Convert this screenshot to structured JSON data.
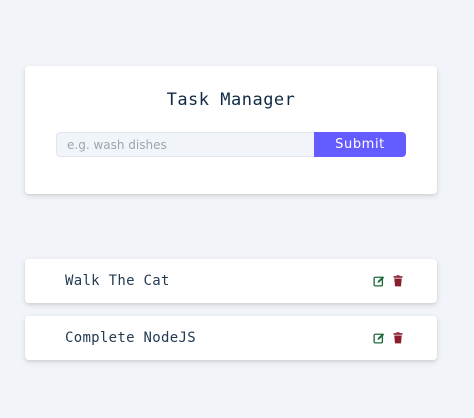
{
  "app": {
    "title": "Task Manager"
  },
  "form": {
    "input_value": "",
    "input_placeholder": "e.g. wash dishes",
    "submit_label": "Submit"
  },
  "tasks": [
    {
      "name": "Walk The Cat",
      "edit_icon": "edit-icon",
      "delete_icon": "trash-icon"
    },
    {
      "name": "Complete NodeJS",
      "edit_icon": "edit-icon",
      "delete_icon": "trash-icon"
    }
  ],
  "colors": {
    "background": "#f1f4f8",
    "card": "#ffffff",
    "primary": "#645cff",
    "edit_icon": "#1f6a3a",
    "delete_icon": "#8b1e2d",
    "text": "#102a43"
  }
}
